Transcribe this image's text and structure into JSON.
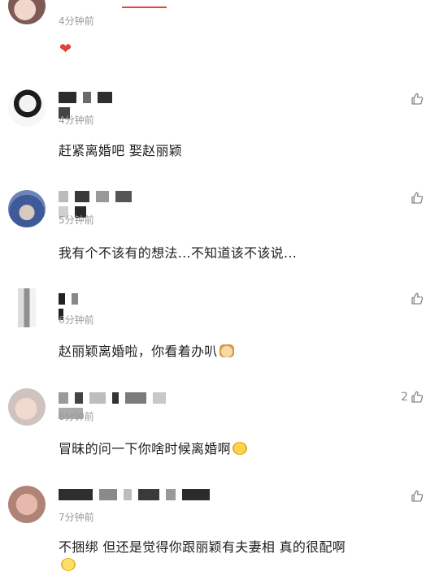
{
  "top_comment": {
    "time": "4分钟前",
    "reaction_icon": "heart-icon"
  },
  "comments": [
    {
      "time": "4分钟前",
      "text": "赶紧离婚吧 娶赵丽颖",
      "likes": ""
    },
    {
      "time": "5分钟前",
      "text": "我有个不该有的想法...不知道该不该说...",
      "likes": ""
    },
    {
      "time": "6分钟前",
      "text": "赵丽颖离婚啦，你看着办叭",
      "likes": ""
    },
    {
      "time": "6分钟前",
      "text": "冒昧的问一下你啥时候离婚啊",
      "likes": "2"
    },
    {
      "time": "7分钟前",
      "text": "不捆绑 但还是觉得你跟丽颖有夫妻相 真的很配啊",
      "likes": ""
    }
  ],
  "colors": {
    "accent": "#e6453a",
    "meta": "#9a9a9a",
    "icon": "#8a8a8a"
  }
}
